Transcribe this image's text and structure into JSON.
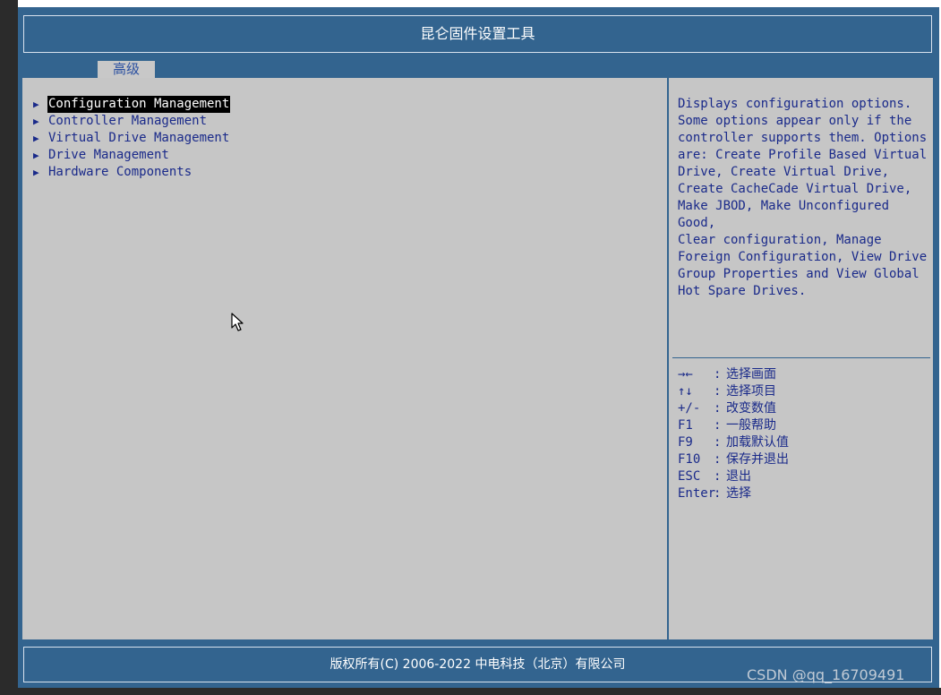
{
  "header": {
    "title": "昆仑固件设置工具"
  },
  "tabs": [
    {
      "label": "高级",
      "active": true
    }
  ],
  "menu": {
    "items": [
      {
        "label": "Configuration Management",
        "selected": true
      },
      {
        "label": "Controller Management",
        "selected": false
      },
      {
        "label": "Virtual Drive Management",
        "selected": false
      },
      {
        "label": "Drive Management",
        "selected": false
      },
      {
        "label": "Hardware Components",
        "selected": false
      }
    ],
    "arrow_glyph": "▶"
  },
  "help": {
    "text": "Displays configuration options.\nSome options appear only if the\ncontroller supports them. Options\nare: Create Profile Based Virtual\nDrive, Create Virtual Drive,\nCreate CacheCade Virtual Drive,\nMake JBOD, Make Unconfigured Good,\nClear configuration, Manage\nForeign Configuration, View Drive\nGroup Properties and View Global\nHot Spare Drives."
  },
  "keys": [
    {
      "key": "→←",
      "sep": ":",
      "desc": "选择画面"
    },
    {
      "key": "↑↓",
      "sep": ":",
      "desc": "选择项目"
    },
    {
      "key": "+/-",
      "sep": ":",
      "desc": "改变数值"
    },
    {
      "key": "F1",
      "sep": ":",
      "desc": "一般帮助"
    },
    {
      "key": "F9",
      "sep": ":",
      "desc": "加载默认值"
    },
    {
      "key": "F10",
      "sep": ":",
      "desc": "保存并退出"
    },
    {
      "key": "ESC",
      "sep": ":",
      "desc": "退出"
    },
    {
      "key": "Enter",
      "sep": ":",
      "desc": "选择"
    }
  ],
  "footer": {
    "copyright": "版权所有(C) 2006-2022 中电科技（北京）有限公司"
  },
  "watermark": {
    "text": "CSDN @qq_16709491"
  },
  "colors": {
    "frame_blue": "#33648f",
    "panel_gray": "#c6c6c6",
    "text_blue": "#1a2a8a",
    "highlight_bg": "#000000",
    "highlight_fg": "#ffffff"
  }
}
